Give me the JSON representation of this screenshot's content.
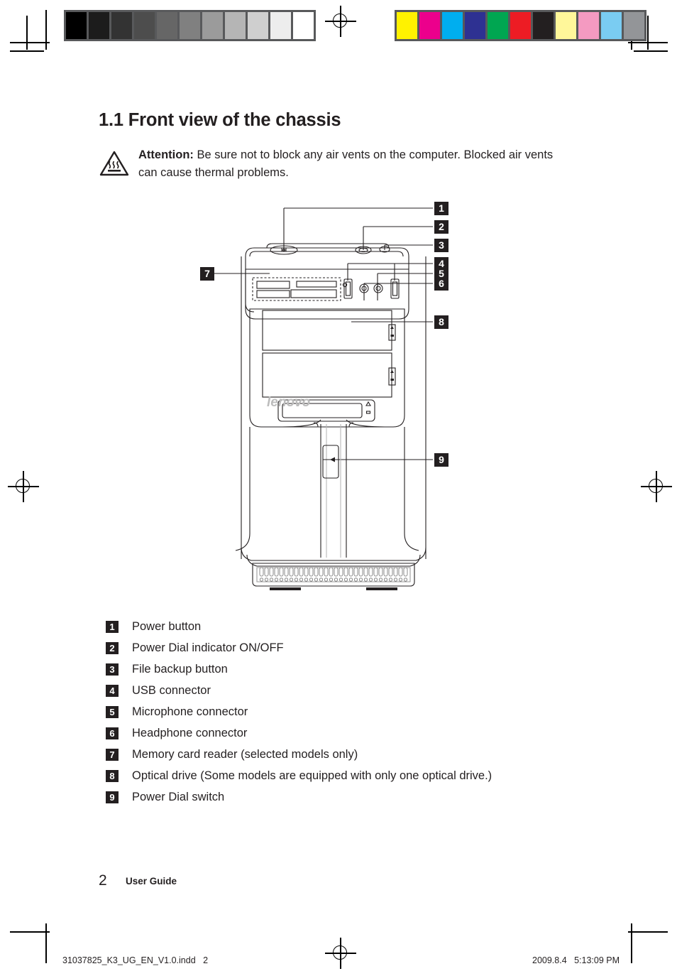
{
  "section": {
    "heading": "1.1 Front view of the chassis"
  },
  "attention": {
    "icon": "hot-surface-warning-icon",
    "label": "Attention:",
    "text": " Be sure not to block any air vents on the computer. Blocked air vents can cause thermal problems."
  },
  "diagram": {
    "product_logo": "lenovo",
    "callouts": [
      {
        "number": "1"
      },
      {
        "number": "2"
      },
      {
        "number": "3"
      },
      {
        "number": "4"
      },
      {
        "number": "5"
      },
      {
        "number": "6"
      },
      {
        "number": "7"
      },
      {
        "number": "8"
      },
      {
        "number": "9"
      }
    ]
  },
  "legend": {
    "items": [
      {
        "number": "1",
        "label": "Power button"
      },
      {
        "number": "2",
        "label": "Power Dial indicator ON/OFF"
      },
      {
        "number": "3",
        "label": "File backup button"
      },
      {
        "number": "4",
        "label": "USB connector"
      },
      {
        "number": "5",
        "label": "Microphone connector"
      },
      {
        "number": "6",
        "label": "Headphone connector"
      },
      {
        "number": "7",
        "label": "Memory card reader (selected models only)"
      },
      {
        "number": "8",
        "label": "Optical drive (Some models are equipped with only one optical drive.)"
      },
      {
        "number": "9",
        "label": "Power Dial switch"
      }
    ]
  },
  "footer": {
    "page_number": "2",
    "document_name": "User Guide",
    "file_name": "31037825_K3_UG_EN_V1.0.indd",
    "file_page": "2",
    "date": "2009.8.4",
    "time": "5:13:09 PM"
  },
  "print_marks": {
    "grayscale_bar": [
      "#000000",
      "#1c1c1c",
      "#333333",
      "#4d4d4d",
      "#666666",
      "#808080",
      "#9b9b9b",
      "#b5b5b5",
      "#cfcfcf",
      "#ededed",
      "#ffffff"
    ],
    "color_bar": [
      "#fff200",
      "#ec008c",
      "#00aeef",
      "#2e3192",
      "#00a651",
      "#ed1c24",
      "#231f20",
      "#fff79a",
      "#f49ac1",
      "#7accf2",
      "#939598"
    ],
    "bar_border": "#58595b"
  }
}
